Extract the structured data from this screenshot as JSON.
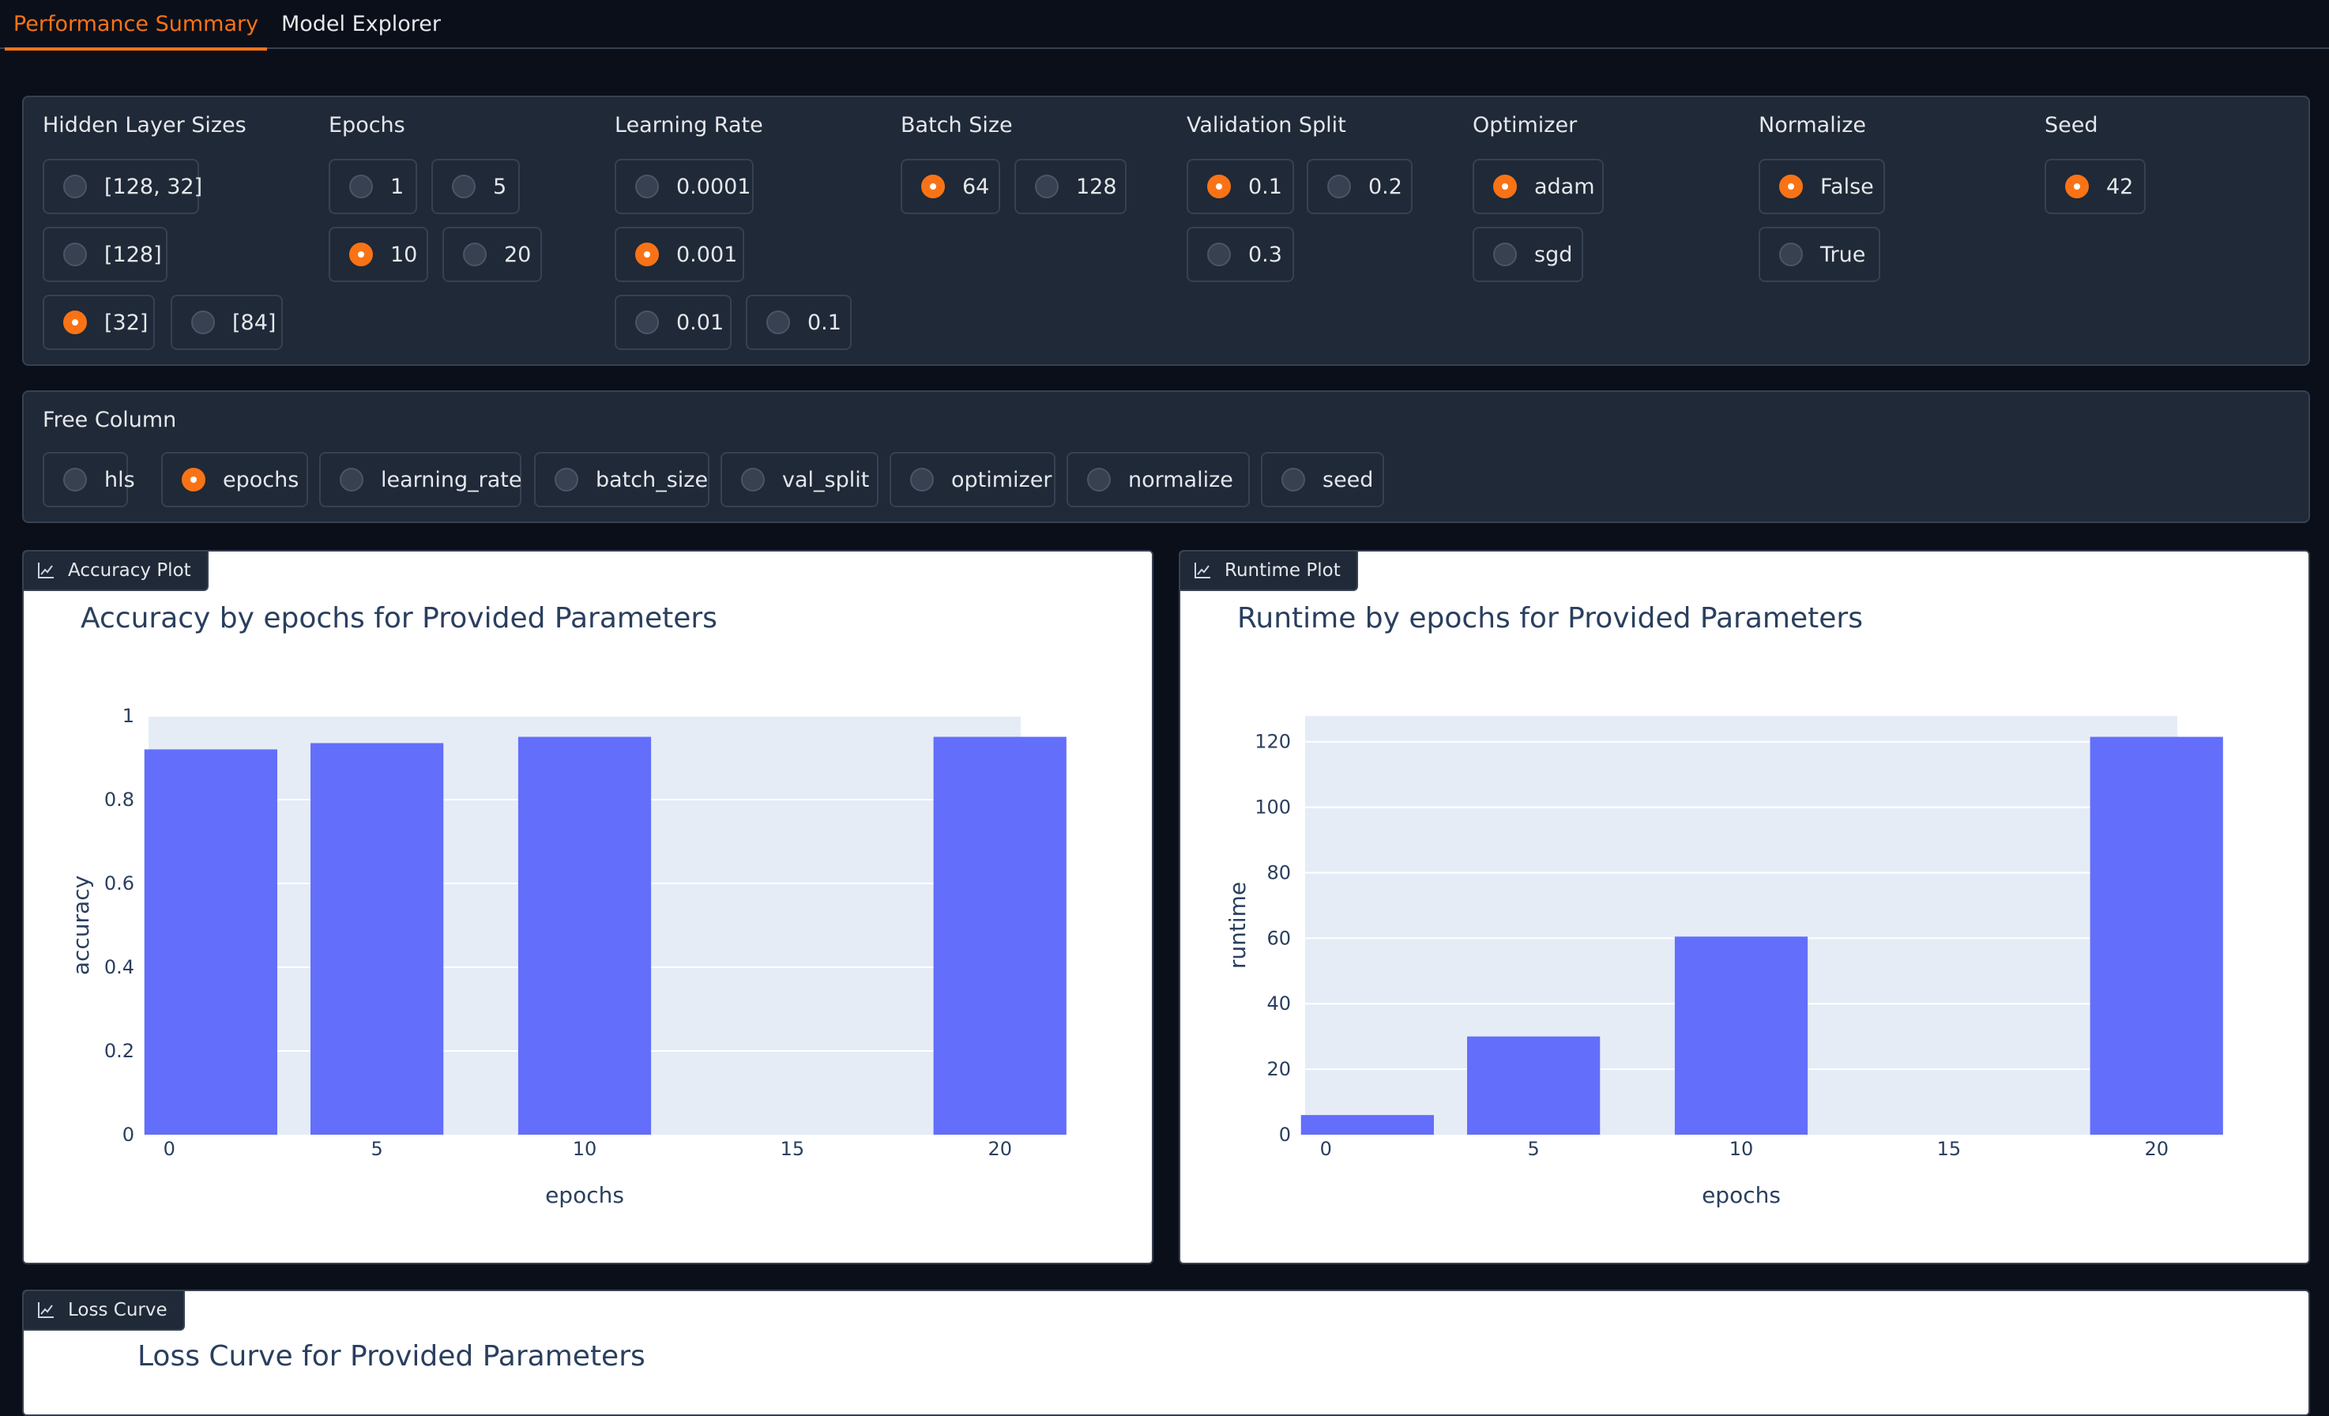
{
  "tabs": [
    {
      "label": "Performance Summary",
      "active": true
    },
    {
      "label": "Model Explorer",
      "active": false
    }
  ],
  "filters": {
    "hidden_layer_sizes": {
      "label": "Hidden Layer Sizes",
      "options": [
        "[128, 32]",
        "[128]",
        "[32]",
        "[84]"
      ],
      "selected": "[32]"
    },
    "epochs": {
      "label": "Epochs",
      "options": [
        "1",
        "5",
        "10",
        "20"
      ],
      "selected": "10"
    },
    "learning_rate": {
      "label": "Learning Rate",
      "options": [
        "0.0001",
        "0.001",
        "0.01",
        "0.1"
      ],
      "selected": "0.001"
    },
    "batch_size": {
      "label": "Batch Size",
      "options": [
        "64",
        "128"
      ],
      "selected": "64"
    },
    "validation_split": {
      "label": "Validation Split",
      "options": [
        "0.1",
        "0.2",
        "0.3"
      ],
      "selected": "0.1"
    },
    "optimizer": {
      "label": "Optimizer",
      "options": [
        "adam",
        "sgd"
      ],
      "selected": "adam"
    },
    "normalize": {
      "label": "Normalize",
      "options": [
        "False",
        "True"
      ],
      "selected": "False"
    },
    "seed": {
      "label": "Seed",
      "options": [
        "42"
      ],
      "selected": "42"
    }
  },
  "free_column": {
    "label": "Free Column",
    "options": [
      "hls",
      "epochs",
      "learning_rate",
      "batch_size",
      "val_split",
      "optimizer",
      "normalize",
      "seed"
    ],
    "selected": "epochs"
  },
  "plots": {
    "accuracy": {
      "badge": "Accuracy Plot"
    },
    "runtime": {
      "badge": "Runtime Plot"
    },
    "loss": {
      "badge": "Loss Curve",
      "title": "Loss Curve for Provided Parameters"
    }
  },
  "colors": {
    "accent": "#f97316",
    "bar": "#636efa",
    "plot_bg": "#e5ecf6",
    "title_text": "#2a3f5f"
  },
  "chart_data": [
    {
      "type": "bar",
      "title": "Accuracy by epochs for Provided Parameters",
      "xlabel": "epochs",
      "ylabel": "accuracy",
      "x": [
        1,
        5,
        10,
        20
      ],
      "values": [
        0.92,
        0.935,
        0.95,
        0.95
      ],
      "xlim": [
        -0.5,
        20.5
      ],
      "ylim": [
        0,
        1
      ],
      "xticks": [
        0,
        5,
        10,
        15,
        20
      ],
      "yticks": [
        0,
        0.2,
        0.4,
        0.6,
        0.8,
        1
      ],
      "ytick_labels": [
        "0",
        "0.2",
        "0.4",
        "0.6",
        "0.8",
        "1"
      ],
      "grid": true
    },
    {
      "type": "bar",
      "title": "Runtime by epochs for Provided Parameters",
      "xlabel": "epochs",
      "ylabel": "runtime",
      "x": [
        1,
        5,
        10,
        20
      ],
      "values": [
        6,
        30,
        60.5,
        121.5
      ],
      "xlim": [
        -0.5,
        20.5
      ],
      "ylim": [
        0,
        127.9
      ],
      "xticks": [
        0,
        5,
        10,
        15,
        20
      ],
      "yticks": [
        0,
        20,
        40,
        60,
        80,
        100,
        120
      ],
      "ytick_labels": [
        "0",
        "20",
        "40",
        "60",
        "80",
        "100",
        "120"
      ],
      "grid": true
    }
  ]
}
